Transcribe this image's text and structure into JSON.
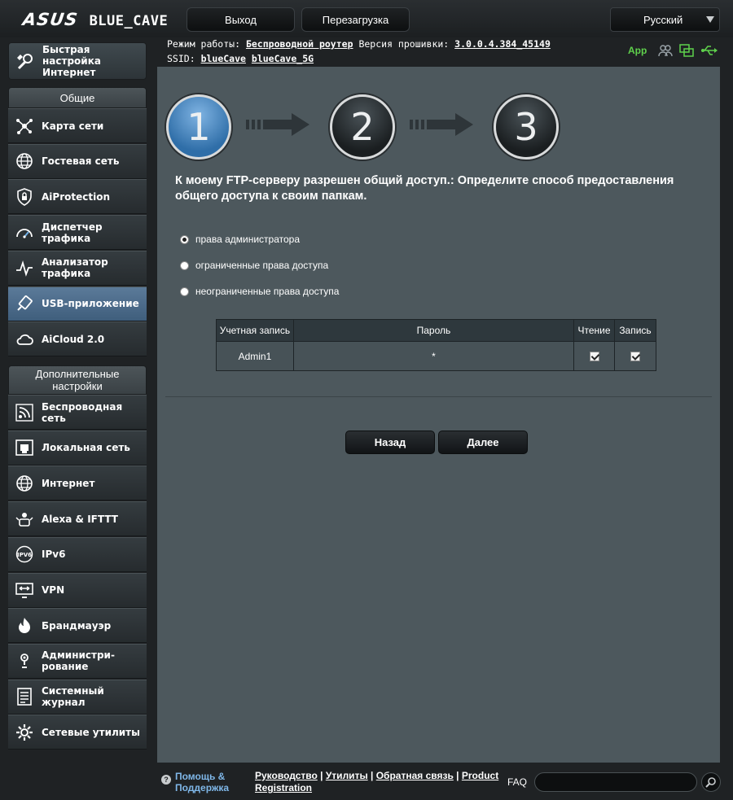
{
  "header": {
    "brand": "ASUS",
    "model": "BLUE_CAVE",
    "logout_label": "Выход",
    "reboot_label": "Перезагрузка",
    "language": "Русский"
  },
  "info": {
    "mode_label": "Режим работы:",
    "mode_value": "Беспроводной роутер",
    "firmware_label": "Версия прошивки:",
    "firmware_value": "3.0.0.4.384_45149",
    "ssid_label": "SSID:",
    "ssid_1": "blueCave",
    "ssid_2": "blueCave_5G",
    "app_label": "App",
    "status_colors": {
      "app": "#5fd14c",
      "usb": "#5fd14c",
      "clients": "#9aa3a8"
    }
  },
  "sidebar": {
    "quick_setup": "Быстрая настройка Интернет",
    "general_header": "Общие",
    "general_items": [
      {
        "label": "Карта сети",
        "icon": "network-map-icon"
      },
      {
        "label": "Гостевая сеть",
        "icon": "globe-guest-icon"
      },
      {
        "label": "AiProtection",
        "icon": "shield-lock-icon"
      },
      {
        "label": "Диспетчер трафика",
        "icon": "gauge-icon"
      },
      {
        "label": "Анализатор трафика",
        "icon": "pulse-icon"
      },
      {
        "label": "USB-приложение",
        "icon": "usb-icon",
        "active": true
      },
      {
        "label": "AiCloud 2.0",
        "icon": "cloud-icon"
      }
    ],
    "advanced_header": "Дополнительные настройки",
    "advanced_items": [
      {
        "label": "Беспроводная сеть",
        "icon": "wireless-icon"
      },
      {
        "label": "Локальная сеть",
        "icon": "lan-icon"
      },
      {
        "label": "Интернет",
        "icon": "globe-icon"
      },
      {
        "label": "Alexa & IFTTT",
        "icon": "alexa-icon"
      },
      {
        "label": "IPv6",
        "icon": "ipv6-icon"
      },
      {
        "label": "VPN",
        "icon": "vpn-icon"
      },
      {
        "label": "Брандмауэр",
        "icon": "firewall-icon"
      },
      {
        "label": "Администри-рование",
        "icon": "admin-icon"
      },
      {
        "label": "Системный журнал",
        "icon": "log-icon"
      },
      {
        "label": "Сетевые утилиты",
        "icon": "tools-icon"
      }
    ]
  },
  "wizard": {
    "steps": [
      "1",
      "2",
      "3"
    ],
    "active_step": 1,
    "headline": "К моему FTP-серверу разрешен общий доступ.: Определите способ предоставления общего доступа к своим папкам.",
    "options": [
      {
        "label": "права администратора",
        "checked": true
      },
      {
        "label": "ограниченные права доступа",
        "checked": false
      },
      {
        "label": "неограниченные права доступа",
        "checked": false
      }
    ],
    "table": {
      "headers": [
        "Учетная запись",
        "Пароль",
        "Чтение",
        "Запись"
      ],
      "rows": [
        {
          "account": "Admin1",
          "password": "*",
          "read": true,
          "write": true
        }
      ]
    },
    "back_label": "Назад",
    "next_label": "Далее"
  },
  "footer": {
    "help_label": "Помощь & Поддержка",
    "link_manual": "Руководство",
    "link_utilities": "Утилиты",
    "link_feedback": "Обратная связь",
    "link_registration": "Product Registration",
    "faq_label": "FAQ",
    "faq_placeholder": ""
  }
}
